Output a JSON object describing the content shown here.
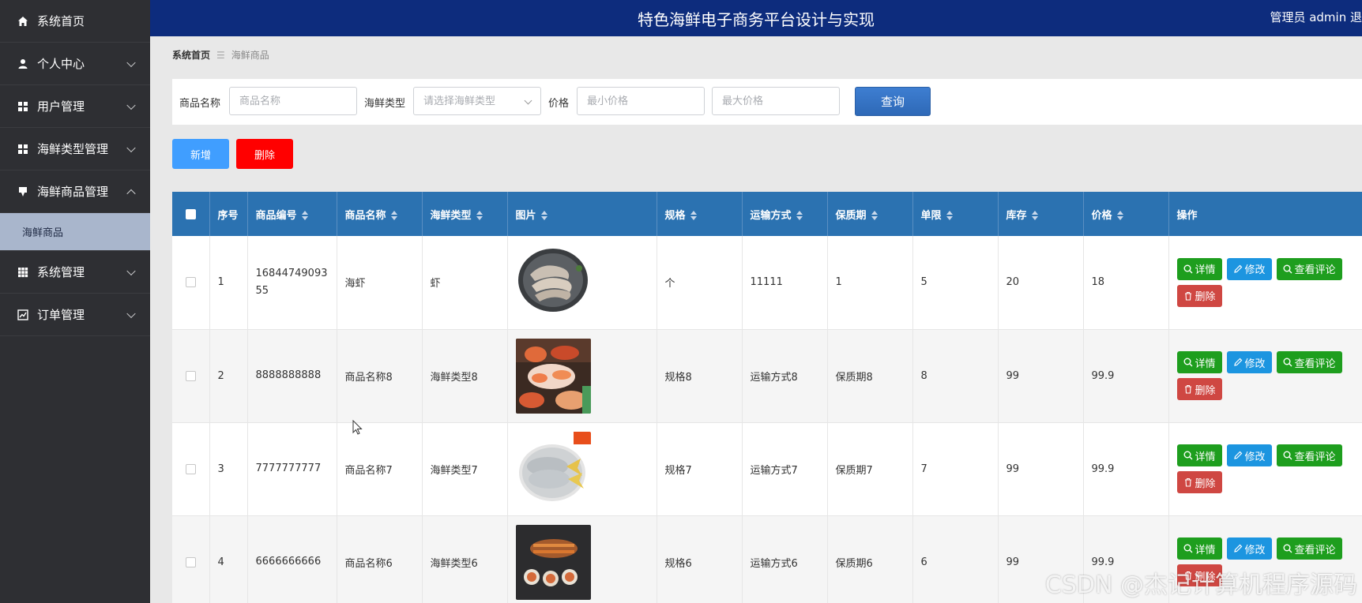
{
  "sidebar": {
    "items": [
      {
        "label": "系统首页",
        "icon": "home-icon"
      },
      {
        "label": "个人中心",
        "icon": "person-icon"
      },
      {
        "label": "用户管理",
        "icon": "grid-icon"
      },
      {
        "label": "海鲜类型管理",
        "icon": "grid-icon"
      },
      {
        "label": "海鲜商品管理",
        "icon": "pin-icon",
        "expanded": true
      },
      {
        "label": "系统管理",
        "icon": "table-icon"
      },
      {
        "label": "订单管理",
        "icon": "chart-icon"
      }
    ],
    "sub_item": "海鲜商品"
  },
  "header": {
    "title": "特色海鲜电子商务平台设计与实现",
    "user": "管理员 admin  退"
  },
  "breadcrumb": {
    "home": "系统首页",
    "current": "海鲜商品"
  },
  "search": {
    "name_label": "商品名称",
    "name_placeholder": "商品名称",
    "type_label": "海鲜类型",
    "type_placeholder": "请选择海鲜类型",
    "price_label": "价格",
    "min_placeholder": "最小价格",
    "max_placeholder": "最大价格",
    "query_label": "查询"
  },
  "actions": {
    "add_label": "新增",
    "delete_label": "删除"
  },
  "table": {
    "headers": [
      "序号",
      "商品编号",
      "商品名称",
      "海鲜类型",
      "图片",
      "规格",
      "运输方式",
      "保质期",
      "单限",
      "库存",
      "价格",
      "操作"
    ],
    "rows": [
      {
        "idx": "1",
        "code": "1684474909355",
        "name": "海虾",
        "type": "虾",
        "spec": "个",
        "ship": "11111",
        "shelf": "1",
        "limit": "5",
        "stock": "20",
        "price": "18"
      },
      {
        "idx": "2",
        "code": "8888888888",
        "name": "商品名称8",
        "type": "海鲜类型8",
        "spec": "规格8",
        "ship": "运输方式8",
        "shelf": "保质期8",
        "limit": "8",
        "stock": "99",
        "price": "99.9"
      },
      {
        "idx": "3",
        "code": "7777777777",
        "name": "商品名称7",
        "type": "海鲜类型7",
        "spec": "规格7",
        "ship": "运输方式7",
        "shelf": "保质期7",
        "limit": "7",
        "stock": "99",
        "price": "99.9"
      },
      {
        "idx": "4",
        "code": "6666666666",
        "name": "商品名称6",
        "type": "海鲜类型6",
        "spec": "规格6",
        "ship": "运输方式6",
        "shelf": "保质期6",
        "limit": "6",
        "stock": "99",
        "price": "99.9"
      }
    ],
    "op_detail": "详情",
    "op_edit": "修改",
    "op_comments": "查看评论",
    "op_delete": "删除"
  },
  "watermark": "CSDN @杰记计算机程序源码",
  "colors": {
    "header_bg": "#0d2c7d",
    "sidebar_bg": "#2e2f33",
    "table_header_bg": "#2b72b1",
    "add_button": "#409eff",
    "delete_button": "#ff0000",
    "op_green": "#1e9e1e",
    "op_blue": "#1c95e0",
    "op_red": "#cf4742"
  }
}
